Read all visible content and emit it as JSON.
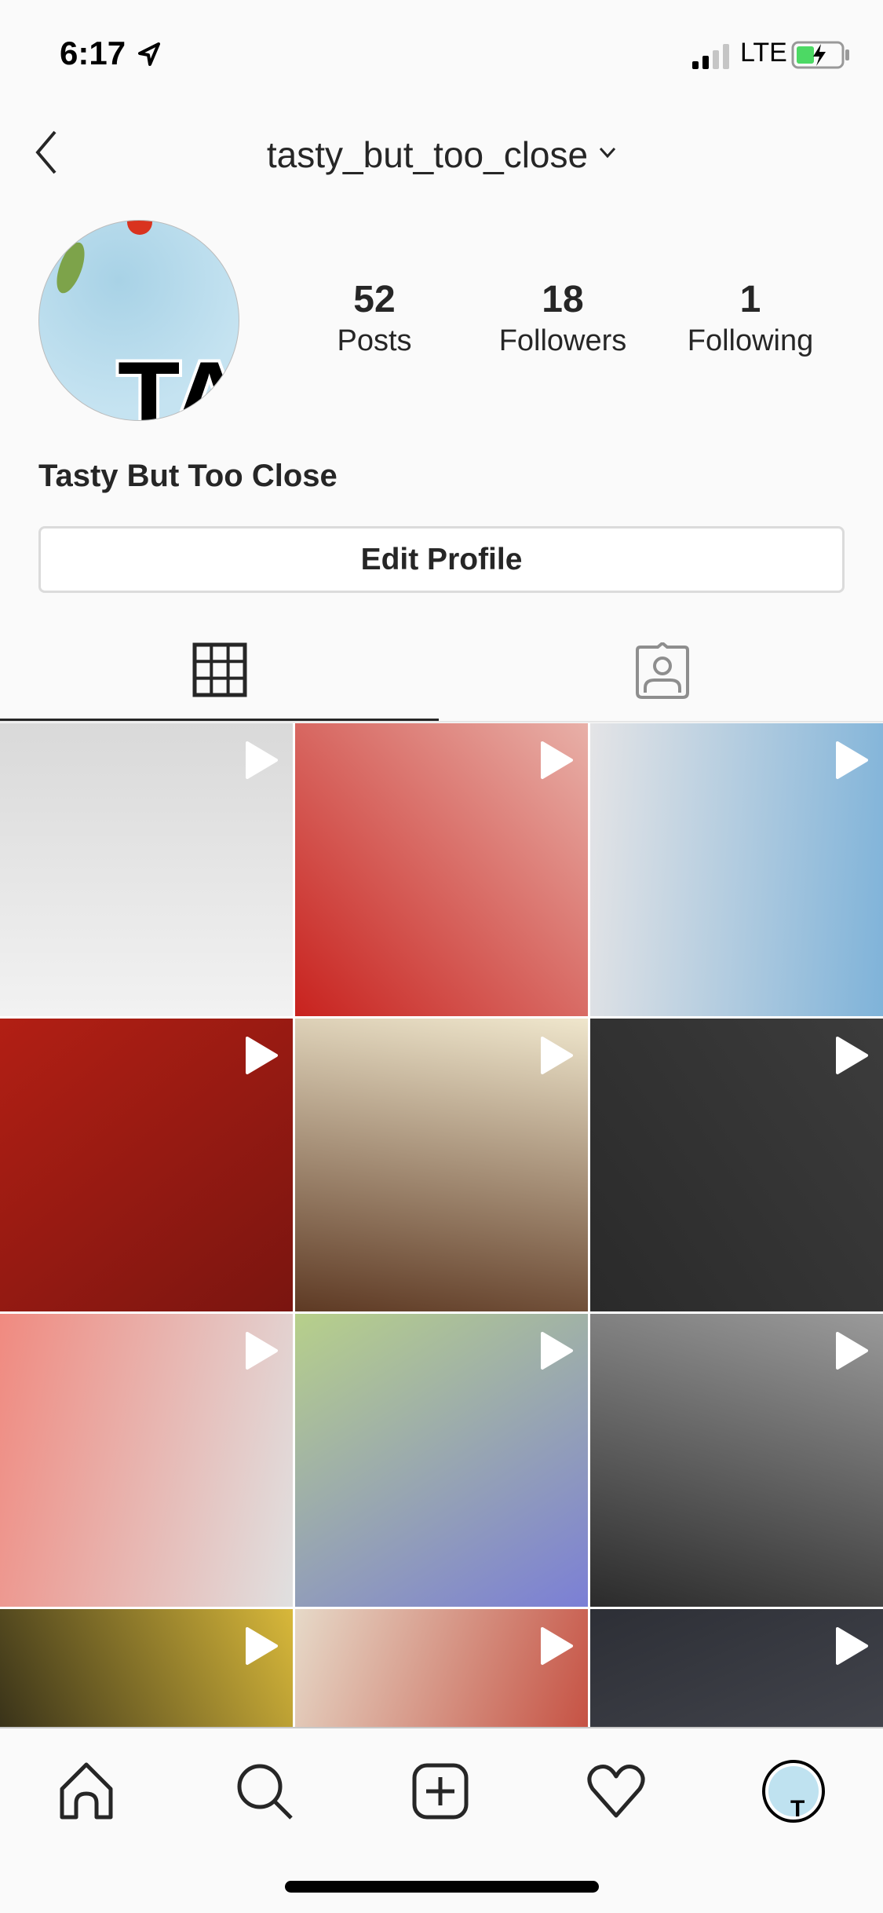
{
  "status_bar": {
    "time": "6:17",
    "network": "LTE",
    "battery_color": "#4cd964"
  },
  "header": {
    "username": "tasty_but_too_close"
  },
  "profile": {
    "avatar_text": "TA",
    "display_name": "Tasty But Too Close",
    "stats": [
      {
        "value": "52",
        "label": "Posts"
      },
      {
        "value": "18",
        "label": "Followers"
      },
      {
        "value": "1",
        "label": "Following"
      }
    ],
    "edit_button": "Edit Profile"
  },
  "tabs": [
    {
      "name": "grid",
      "active": true
    },
    {
      "name": "tagged",
      "active": false
    }
  ],
  "posts": [
    {
      "type": "video",
      "colors": [
        "#f2f2f2",
        "#d9d9d9"
      ]
    },
    {
      "type": "video",
      "colors": [
        "#c8221e",
        "#e8b0a8"
      ]
    },
    {
      "type": "video",
      "colors": [
        "#e4e4e6",
        "#7fb3d9"
      ]
    },
    {
      "type": "video",
      "colors": [
        "#b21f14",
        "#7a1510"
      ]
    },
    {
      "type": "video",
      "colors": [
        "#5e3a24",
        "#efe6cc"
      ]
    },
    {
      "type": "video",
      "colors": [
        "#2a2a2a",
        "#3c3c3c"
      ]
    },
    {
      "type": "video",
      "colors": [
        "#f08a80",
        "#e0e0e0"
      ]
    },
    {
      "type": "video",
      "colors": [
        "#b7d08a",
        "#7b7fd6"
      ]
    },
    {
      "type": "video",
      "colors": [
        "#2b2b2b",
        "#9a9a9a"
      ]
    },
    {
      "type": "video",
      "colors": [
        "#111111",
        "#d8b83a"
      ]
    },
    {
      "type": "video",
      "colors": [
        "#e6d9c8",
        "#c0392b"
      ]
    },
    {
      "type": "video",
      "colors": [
        "#2d2f36",
        "#50525a"
      ]
    }
  ],
  "bottom_nav": [
    "home",
    "search",
    "new-post",
    "activity",
    "profile"
  ]
}
